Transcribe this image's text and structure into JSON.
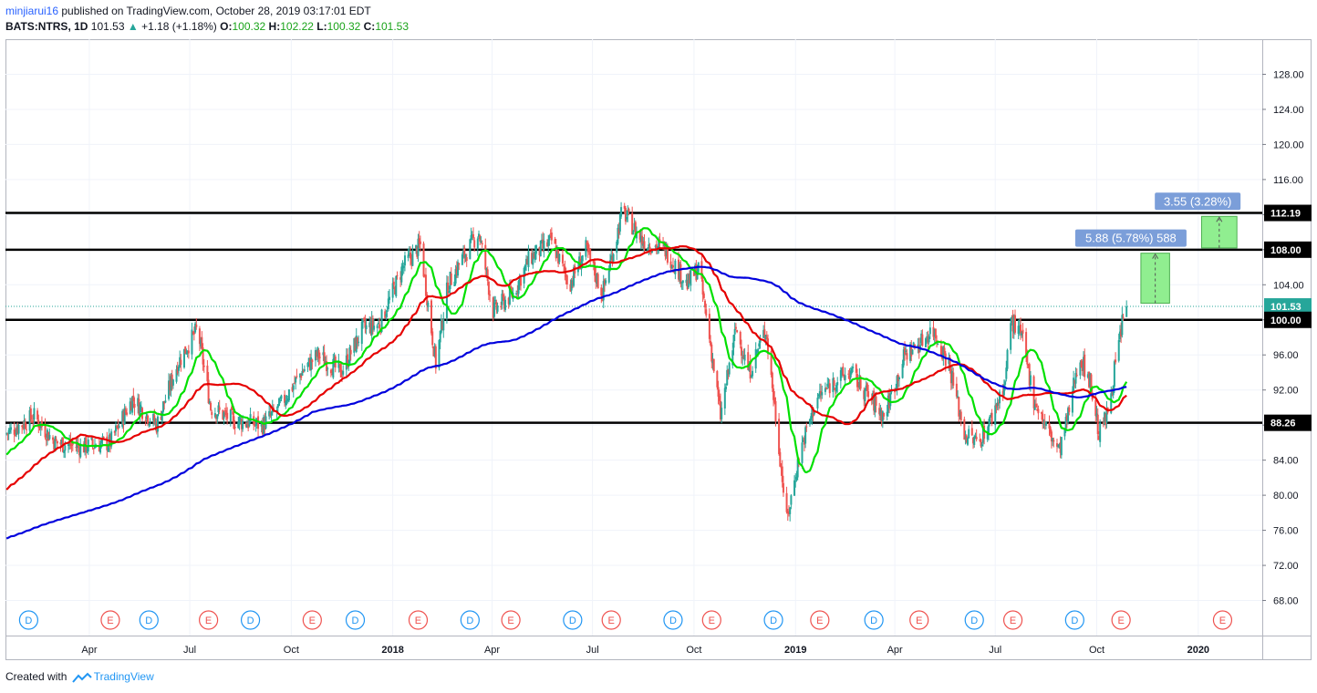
{
  "header": {
    "author": "minjiarui16",
    "published_text": "published on TradingView.com, October 28, 2019 03:17:01 EDT",
    "symbol": "BATS:NTRS, 1D",
    "last": "101.53",
    "change": "+1.18 (+1.18%)",
    "o_label": "O:",
    "o": "100.32",
    "h_label": "H:",
    "h": "102.22",
    "l_label": "L:",
    "l": "100.32",
    "c_label": "C:",
    "c": "101.53"
  },
  "footer": {
    "created_with": "Created with",
    "brand": "TradingView"
  },
  "colors": {
    "up": "#26a69a",
    "down": "#ef5350",
    "ma_fast": "#00e000",
    "ma_mid": "#e60000",
    "ma_slow": "#0000dd",
    "level": "#000000",
    "label_bg": "#7b9ed9",
    "target_box": "#90ee90"
  },
  "chart_data": {
    "type": "candlestick",
    "symbol": "BATS:NTRS",
    "interval": "1D",
    "ylim": [
      64,
      132
    ],
    "y_ticks": [
      68,
      72,
      76,
      80,
      84,
      88,
      92,
      96,
      100,
      104,
      108,
      112,
      116,
      120,
      124,
      128
    ],
    "y_tick_labels": [
      "68.00",
      "72.00",
      "76.00",
      "80.00",
      "84.00",
      "88.00",
      "92.00",
      "96.00",
      "100.00",
      "104.00",
      "108.00",
      "112.00",
      "116.00",
      "120.00",
      "124.00",
      "128.00"
    ],
    "x_range": [
      "2017-01-15",
      "2020-02-28"
    ],
    "x_ticks": [
      {
        "date": "2017-04-01",
        "label": "Apr",
        "bold": false
      },
      {
        "date": "2017-07-01",
        "label": "Jul",
        "bold": false
      },
      {
        "date": "2017-10-01",
        "label": "Oct",
        "bold": false
      },
      {
        "date": "2018-01-01",
        "label": "2018",
        "bold": true
      },
      {
        "date": "2018-04-01",
        "label": "Apr",
        "bold": false
      },
      {
        "date": "2018-07-01",
        "label": "Jul",
        "bold": false
      },
      {
        "date": "2018-10-01",
        "label": "Oct",
        "bold": false
      },
      {
        "date": "2019-01-01",
        "label": "2019",
        "bold": true
      },
      {
        "date": "2019-04-01",
        "label": "Apr",
        "bold": false
      },
      {
        "date": "2019-07-01",
        "label": "Jul",
        "bold": false
      },
      {
        "date": "2019-10-01",
        "label": "Oct",
        "bold": false
      },
      {
        "date": "2020-01-01",
        "label": "2020",
        "bold": true
      }
    ],
    "grid": true,
    "price_anchors": [
      [
        "2017-01-15",
        87
      ],
      [
        "2017-02-10",
        89
      ],
      [
        "2017-03-01",
        86
      ],
      [
        "2017-03-25",
        85.5
      ],
      [
        "2017-04-20",
        86
      ],
      [
        "2017-05-10",
        91
      ],
      [
        "2017-06-01",
        88
      ],
      [
        "2017-06-20",
        95
      ],
      [
        "2017-07-08",
        99
      ],
      [
        "2017-07-20",
        90
      ],
      [
        "2017-08-10",
        88.5
      ],
      [
        "2017-09-05",
        88
      ],
      [
        "2017-09-20",
        90
      ],
      [
        "2017-10-10",
        94
      ],
      [
        "2017-10-25",
        96
      ],
      [
        "2017-11-15",
        94
      ],
      [
        "2017-12-05",
        99
      ],
      [
        "2017-12-20",
        99.5
      ],
      [
        "2018-01-10",
        106
      ],
      [
        "2018-01-26",
        108.5
      ],
      [
        "2018-02-09",
        95
      ],
      [
        "2018-02-20",
        104
      ],
      [
        "2018-03-05",
        107
      ],
      [
        "2018-03-20",
        110
      ],
      [
        "2018-04-02",
        101
      ],
      [
        "2018-04-20",
        103
      ],
      [
        "2018-05-05",
        107
      ],
      [
        "2018-05-25",
        109
      ],
      [
        "2018-06-10",
        104
      ],
      [
        "2018-06-25",
        108
      ],
      [
        "2018-07-10",
        103
      ],
      [
        "2018-07-22",
        109
      ],
      [
        "2018-07-28",
        112.5
      ],
      [
        "2018-08-15",
        109
      ],
      [
        "2018-09-05",
        108
      ],
      [
        "2018-09-25",
        104
      ],
      [
        "2018-10-05",
        106
      ],
      [
        "2018-10-15",
        98
      ],
      [
        "2018-10-25",
        89
      ],
      [
        "2018-11-08",
        99
      ],
      [
        "2018-11-20",
        94
      ],
      [
        "2018-12-05",
        99
      ],
      [
        "2018-12-15",
        88
      ],
      [
        "2018-12-24",
        77
      ],
      [
        "2019-01-05",
        85
      ],
      [
        "2019-01-20",
        91
      ],
      [
        "2019-02-05",
        93
      ],
      [
        "2019-02-20",
        94
      ],
      [
        "2019-03-10",
        91
      ],
      [
        "2019-03-22",
        89
      ],
      [
        "2019-04-10",
        96
      ],
      [
        "2019-04-25",
        97.5
      ],
      [
        "2019-05-05",
        99
      ],
      [
        "2019-05-20",
        95
      ],
      [
        "2019-06-03",
        87
      ],
      [
        "2019-06-15",
        86
      ],
      [
        "2019-06-25",
        88
      ],
      [
        "2019-07-10",
        93
      ],
      [
        "2019-07-15",
        100
      ],
      [
        "2019-07-25",
        98
      ],
      [
        "2019-08-05",
        91
      ],
      [
        "2019-08-15",
        88
      ],
      [
        "2019-08-28",
        85
      ],
      [
        "2019-09-05",
        89
      ],
      [
        "2019-09-15",
        96
      ],
      [
        "2019-09-25",
        93
      ],
      [
        "2019-10-03",
        87
      ],
      [
        "2019-10-10",
        89
      ],
      [
        "2019-10-18",
        95
      ],
      [
        "2019-10-25",
        100.3
      ],
      [
        "2019-10-28",
        101.53
      ]
    ],
    "last_close": 101.53,
    "horizontal_levels": [
      112.19,
      108.0,
      100.0,
      88.26
    ],
    "price_labels": [
      "112.19",
      "108.00",
      "101.53",
      "100.00",
      "88.26"
    ],
    "moving_averages": [
      {
        "color": "#00e000",
        "start": 84.5
      },
      {
        "color": "#e60000",
        "start": 80.5
      },
      {
        "color": "#0000dd",
        "start": 75
      }
    ],
    "projections": [
      {
        "start_date": "2019-11-10",
        "end_date": "2019-12-06",
        "from": 101.9,
        "to": 107.6,
        "label": "5.88 (5.78%) 588"
      },
      {
        "start_date": "2020-01-04",
        "end_date": "2020-02-05",
        "from": 108.2,
        "to": 111.8,
        "label": "3.55 (3.28%)"
      }
    ],
    "events": [
      {
        "date": "2017-02-05",
        "type": "D"
      },
      {
        "date": "2017-04-20",
        "type": "E"
      },
      {
        "date": "2017-05-25",
        "type": "D"
      },
      {
        "date": "2017-07-18",
        "type": "E"
      },
      {
        "date": "2017-08-25",
        "type": "D"
      },
      {
        "date": "2017-10-20",
        "type": "E"
      },
      {
        "date": "2017-11-28",
        "type": "D"
      },
      {
        "date": "2018-01-24",
        "type": "E"
      },
      {
        "date": "2018-03-12",
        "type": "D"
      },
      {
        "date": "2018-04-18",
        "type": "E"
      },
      {
        "date": "2018-06-13",
        "type": "D"
      },
      {
        "date": "2018-07-18",
        "type": "E"
      },
      {
        "date": "2018-09-12",
        "type": "D"
      },
      {
        "date": "2018-10-17",
        "type": "E"
      },
      {
        "date": "2018-12-12",
        "type": "D"
      },
      {
        "date": "2019-01-23",
        "type": "E"
      },
      {
        "date": "2019-03-13",
        "type": "D"
      },
      {
        "date": "2019-04-23",
        "type": "E"
      },
      {
        "date": "2019-06-12",
        "type": "D"
      },
      {
        "date": "2019-07-17",
        "type": "E"
      },
      {
        "date": "2019-09-11",
        "type": "D"
      },
      {
        "date": "2019-10-23",
        "type": "E"
      },
      {
        "date": "2020-01-23",
        "type": "E"
      }
    ]
  }
}
